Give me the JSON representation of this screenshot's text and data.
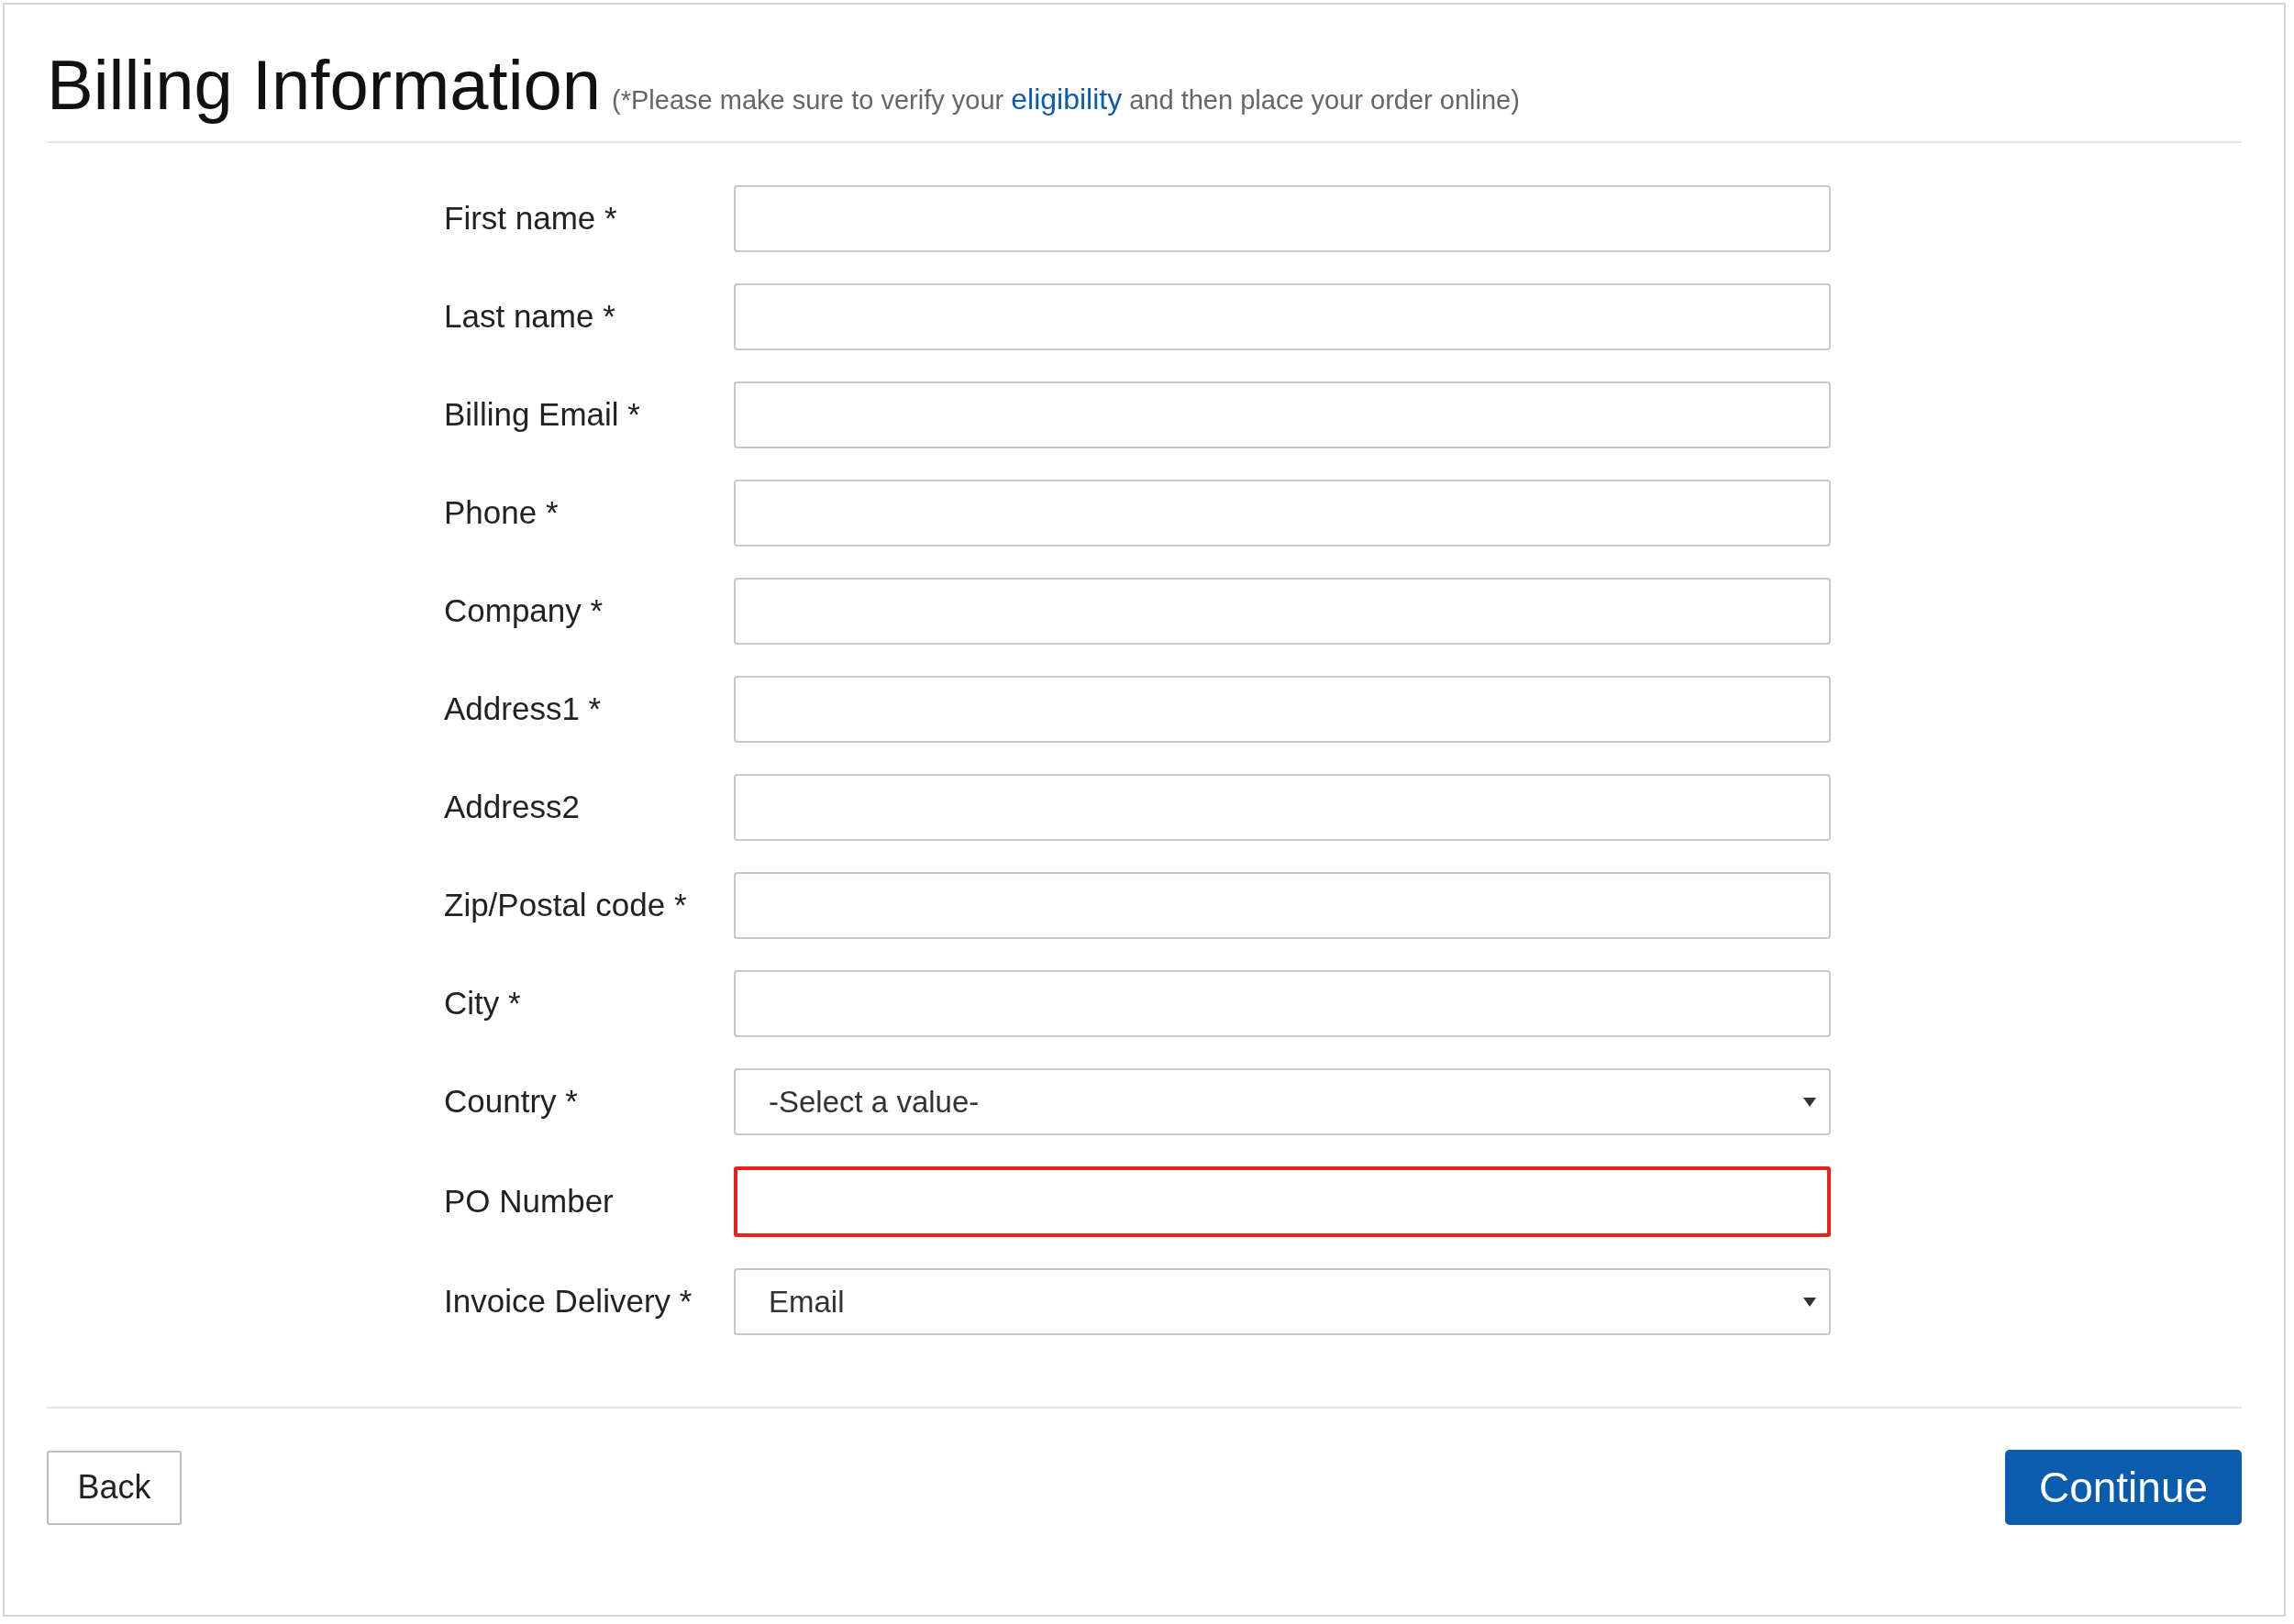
{
  "header": {
    "title": "Billing Information",
    "note_before": "(*Please make sure to verify your ",
    "link": "eligibility",
    "note_after": " and then place your order online)"
  },
  "fields": [
    {
      "label": "First name *",
      "kind": "text",
      "error": false
    },
    {
      "label": "Last name *",
      "kind": "text",
      "error": false
    },
    {
      "label": "Billing Email *",
      "kind": "text",
      "error": false
    },
    {
      "label": "Phone *",
      "kind": "text",
      "error": false
    },
    {
      "label": "Company *",
      "kind": "text",
      "error": false
    },
    {
      "label": "Address1 *",
      "kind": "text",
      "error": false
    },
    {
      "label": "Address2",
      "kind": "text",
      "error": false
    },
    {
      "label": "Zip/Postal code *",
      "kind": "text",
      "error": false
    },
    {
      "label": "City *",
      "kind": "text",
      "error": false
    },
    {
      "label": "Country *",
      "kind": "select",
      "value": "-Select a value-",
      "error": false
    },
    {
      "label": "PO Number",
      "kind": "text",
      "error": true
    },
    {
      "label": "Invoice Delivery *",
      "kind": "select",
      "value": "Email",
      "error": false
    }
  ],
  "buttons": {
    "back": "Back",
    "continue": "Continue"
  }
}
